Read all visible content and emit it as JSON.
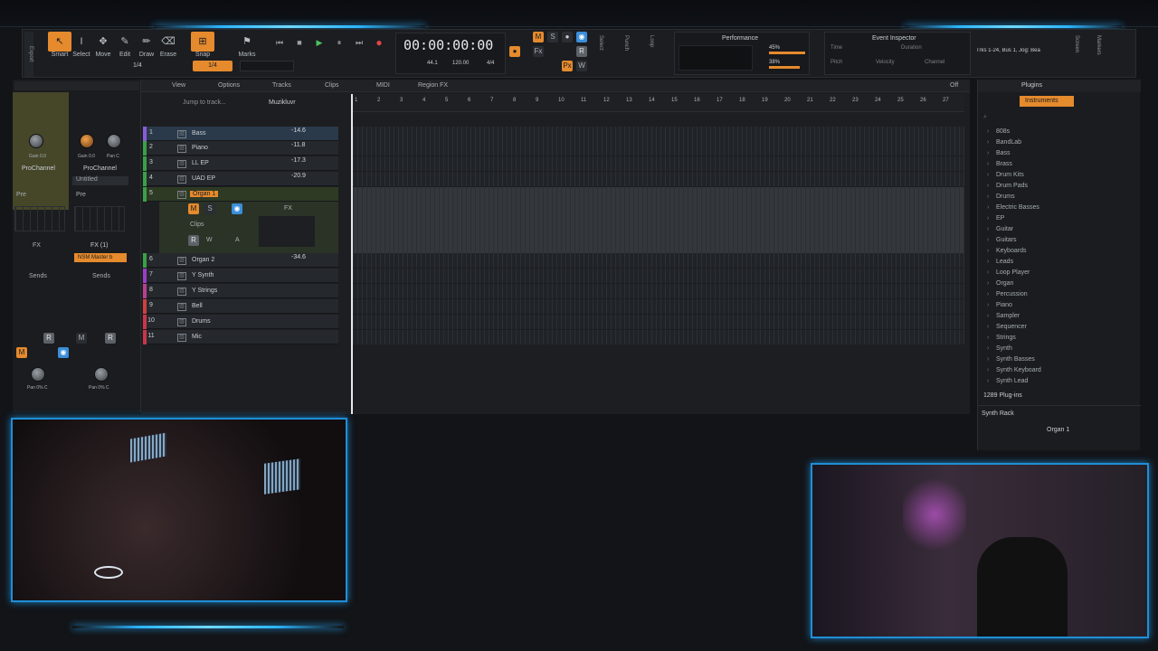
{
  "tools": [
    {
      "label": "Smart"
    },
    {
      "label": "Select"
    },
    {
      "label": "Move"
    },
    {
      "label": "Edit"
    },
    {
      "label": "Draw"
    },
    {
      "label": "Erase"
    }
  ],
  "snap": {
    "label": "Snap",
    "value": "1/4"
  },
  "marks_label": "Marks",
  "time": "00:00:00:00",
  "tempo": "120.00",
  "meter": "4/4",
  "bpm_small": "44.1",
  "perf": {
    "title": "Performance",
    "cpu": "45%",
    "disk": "38%"
  },
  "event_inspector": {
    "title": "Event Inspector",
    "fields": [
      "Time",
      "Duration",
      "Pitch",
      "Velocity",
      "Channel"
    ]
  },
  "track_info": "Trks 1-24, Bus 1, Jog: Bea",
  "right_tabs": [
    "Screen",
    "Markers"
  ],
  "punch": "Punch",
  "loop": "Loop",
  "select": "Select",
  "inspector": {
    "gain_l": "Gain 0.0",
    "pan_l": "Pan C",
    "gain_r": "Gain 0.0",
    "pan_r": "Pan C",
    "prochannel": "ProChannel",
    "prochannel2": "ProChannel",
    "untitled": "Untitled",
    "pre": "Pre",
    "fx_l": "FX",
    "fx_r": "FX (1)",
    "plugin": "NSM Master b",
    "sends": "Sends",
    "sends2": "Sends",
    "pan_bottom_l": "Pan 0% C",
    "pan_bottom_r": "Pan 0% C",
    "btns": [
      "M",
      "S",
      "R",
      "W"
    ]
  },
  "menu": [
    "View",
    "Options",
    "Tracks",
    "Clips",
    "MIDI",
    "Region FX"
  ],
  "jump": "Jump to track...",
  "user": "Muzikluvr",
  "off": "Off",
  "ruler": [
    "1",
    "2",
    "3",
    "4",
    "5",
    "6",
    "7",
    "8",
    "9",
    "10",
    "11",
    "12",
    "13",
    "14",
    "15",
    "16",
    "17",
    "18",
    "19",
    "20",
    "21",
    "22",
    "23",
    "24",
    "25",
    "26",
    "27"
  ],
  "tracks": [
    {
      "n": "1",
      "name": "Bass",
      "vol": "-14.6",
      "color": "#8a5bd8"
    },
    {
      "n": "2",
      "name": "Piano",
      "vol": "-11.8",
      "color": "#3ba047"
    },
    {
      "n": "3",
      "name": "LL EP",
      "vol": "-17.3",
      "color": "#3ba047"
    },
    {
      "n": "4",
      "name": "UAD EP",
      "vol": "-20.9",
      "color": "#3ba047"
    },
    {
      "n": "5",
      "name": "Organ 1",
      "vol": "",
      "color": "#3ba047"
    },
    {
      "n": "6",
      "name": "Organ 2",
      "vol": "-34.6",
      "color": "#3ba047"
    },
    {
      "n": "7",
      "name": "Y Synth",
      "vol": "",
      "color": "#9a3ec8"
    },
    {
      "n": "8",
      "name": "Y Strings",
      "vol": "",
      "color": "#b8418f"
    },
    {
      "n": "9",
      "name": "Bell",
      "vol": "",
      "color": "#d04040"
    },
    {
      "n": "10",
      "name": "Drums",
      "vol": "",
      "color": "#c8364a"
    },
    {
      "n": "11",
      "name": "Mic",
      "vol": "",
      "color": "#c8364a"
    }
  ],
  "organ_expanded": {
    "clips": "Clips",
    "fx": "FX",
    "btns": [
      "M",
      "S"
    ],
    "row2": [
      "R",
      "W",
      "A"
    ]
  },
  "browser": {
    "tabs": [
      "Plugins"
    ],
    "sub": "Instruments",
    "items": [
      "808s",
      "BandLab",
      "Bass",
      "Brass",
      "Drum Kits",
      "Drum Pads",
      "Drums",
      "Electric Basses",
      "EP",
      "Guitar",
      "Guitars",
      "Keyboards",
      "Leads",
      "Loop Player",
      "Organ",
      "Percussion",
      "Piano",
      "Sampler",
      "Sequencer",
      "Strings",
      "Synth",
      "Synth Basses",
      "Synth Keyboard",
      "Synth Lead"
    ],
    "count": "1289 Plug-ins",
    "rack": "Synth Rack",
    "rack_item": "Organ 1"
  }
}
